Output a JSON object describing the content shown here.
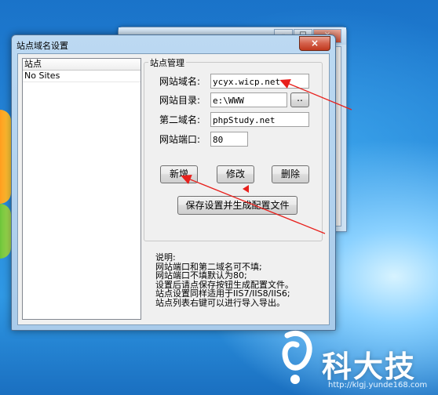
{
  "bg_window": {
    "caption_min": "–",
    "caption_max": "□",
    "caption_close": "×"
  },
  "dialog": {
    "title": "站点域名设置",
    "close_glyph": "×"
  },
  "site_list": {
    "header": "站点",
    "items": [
      "No Sites"
    ]
  },
  "group": {
    "title": "站点管理",
    "domain_label": "网站域名:",
    "domain_value": "ycyx.wicp.net",
    "dir_label": "网站目录:",
    "dir_value": "e:\\WWW",
    "browse_label": "..",
    "second_domain_label": "第二域名:",
    "second_domain_value": "phpStudy.net",
    "port_label": "网站端口:",
    "port_value": "80",
    "add_label": "新增",
    "edit_label": "修改",
    "delete_label": "删除",
    "save_label": "保存设置并生成配置文件"
  },
  "notes": {
    "lines": [
      "说明:",
      "网站端口和第二域名可不填;",
      "网站端口不填默认为80;",
      "设置后请点保存按钮生成配置文件。",
      "站点设置同样适用于IIS7/IIS8/IIS6;",
      "站点列表右键可以进行导入导出。"
    ]
  },
  "watermark": {
    "brand": "科大技",
    "url": "http://klgj.yunde168.com"
  },
  "colors": {
    "annotation_red": "#e8201c"
  }
}
